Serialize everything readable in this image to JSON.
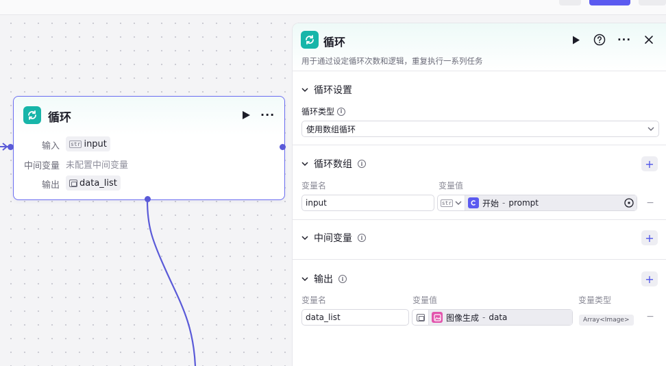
{
  "node": {
    "title": "循环",
    "rows": [
      {
        "label": "输入",
        "type": "str",
        "value": "input"
      },
      {
        "label": "中间变量",
        "value": "未配置中间变量"
      },
      {
        "label": "输出",
        "type": "image",
        "value": "data_list"
      }
    ],
    "icons": {
      "app": "loop-icon",
      "run": "play-icon",
      "more": "more-icon"
    }
  },
  "panel": {
    "title": "循环",
    "description": "用于通过设定循环次数和逻辑，重复执行一系列任务",
    "loop_settings": {
      "title": "循环设置",
      "type_label": "循环类型",
      "type_value": "使用数组循环"
    },
    "loop_array": {
      "title": "循环数组",
      "name_header": "变量名",
      "value_header": "变量值",
      "name_value": "input",
      "type_tag": "str",
      "ref_source": "开始",
      "ref_sep": "-",
      "ref_field": "prompt"
    },
    "intermediate": {
      "title": "中间变量"
    },
    "output": {
      "title": "输出",
      "name_header": "变量名",
      "value_header": "变量值",
      "type_header": "变量类型",
      "name_value": "data_list",
      "ref_source": "图像生成",
      "ref_sep": "-",
      "ref_field": "data",
      "type_value": "Array<Image>"
    }
  },
  "colors": {
    "accent": "#5b5af0",
    "loop_icon": "#17b5a9",
    "image_gen": "#e255ad",
    "node_border": "#6a6df0"
  }
}
